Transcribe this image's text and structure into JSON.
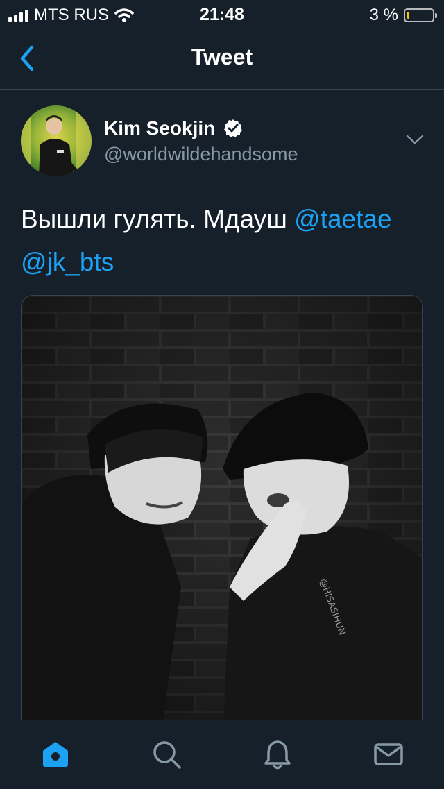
{
  "status": {
    "carrier": "MTS RUS",
    "time": "21:48",
    "battery": "3 %",
    "battery_level": 0.03
  },
  "nav": {
    "title": "Tweet",
    "back_icon": "chevron-left-icon"
  },
  "tweet": {
    "display_name": "Kim Seokjin",
    "handle": "@worldwildehandsome",
    "verified": true,
    "text": "Вышли гулять. Мдауш",
    "mentions": [
      "@taetae",
      "@jk_bts"
    ],
    "photo_watermark": "@HISASIHUN"
  },
  "tabs": [
    "home-icon",
    "search-icon",
    "notifications-icon",
    "messages-icon"
  ],
  "colors": {
    "background": "#15202b",
    "accent": "#1da1f2",
    "secondary_text": "#8899a6",
    "divider": "#38444d"
  }
}
